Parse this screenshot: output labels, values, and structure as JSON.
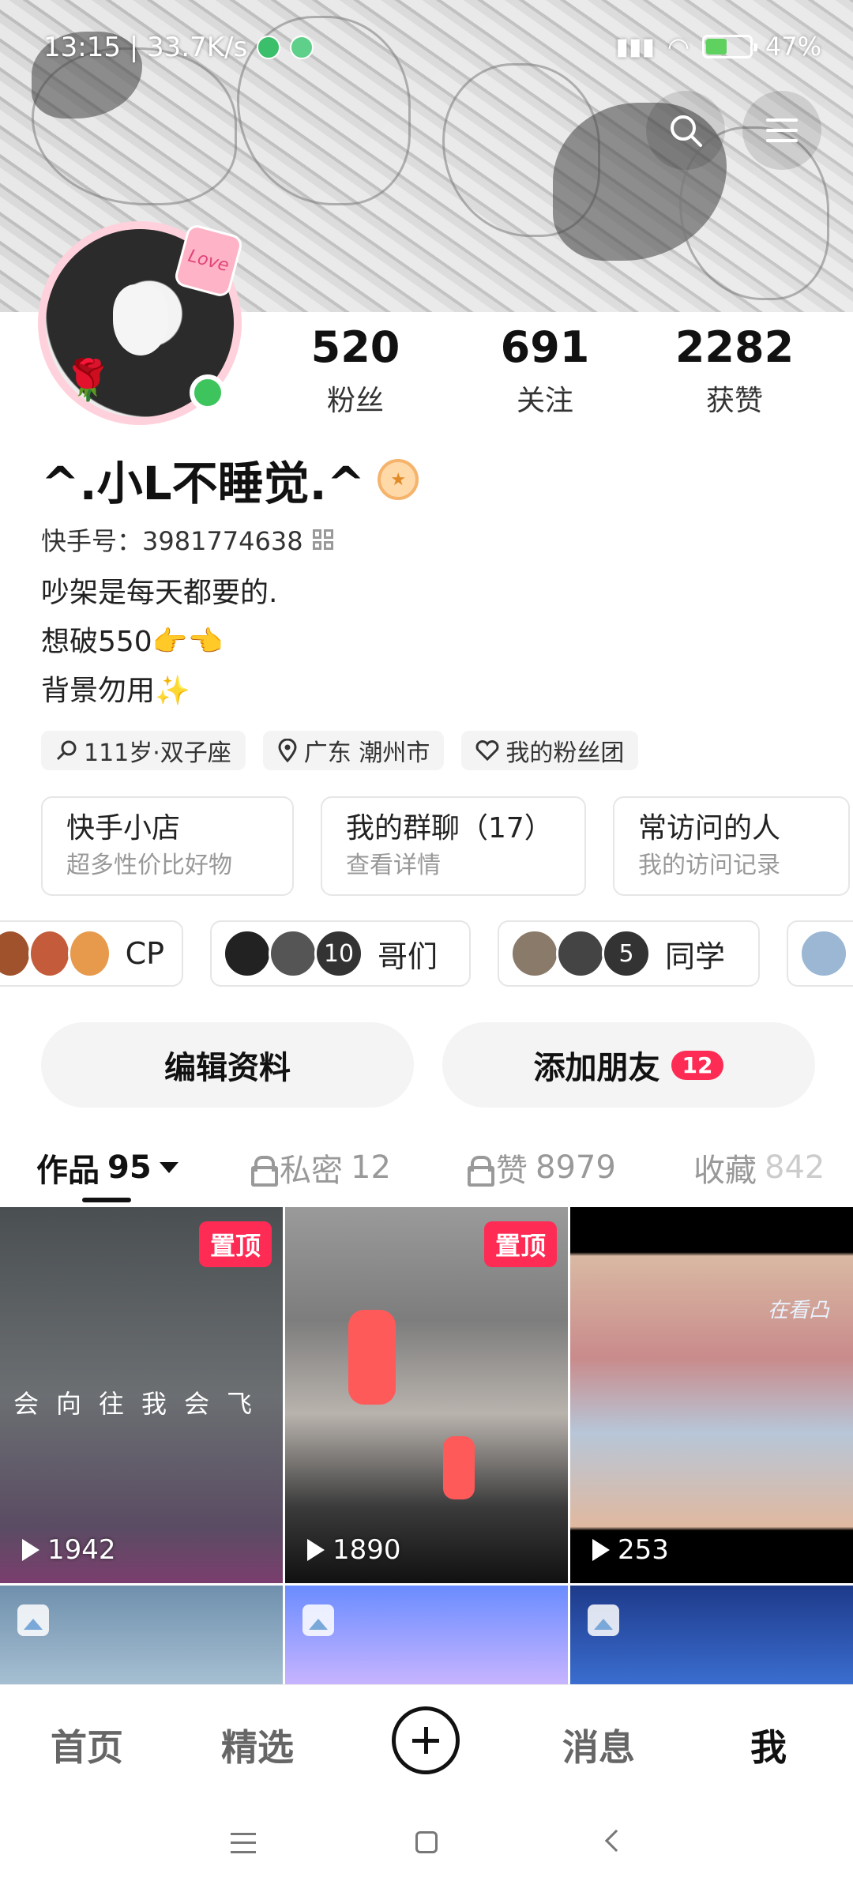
{
  "status_bar": {
    "time_speed": "13:15 | 33.7K/s",
    "battery": "47%"
  },
  "profile": {
    "username": "^.小L不睡觉.^",
    "user_id_label": "快手号：3981774638",
    "bio_lines": [
      "吵架是每天都要的.",
      "想破550👉👈",
      "背景勿用✨"
    ],
    "avatar_tag": "Love",
    "tags": [
      {
        "icon": "gender-icon",
        "label": "111岁·双子座"
      },
      {
        "icon": "location-icon",
        "label": "广东 潮州市"
      },
      {
        "icon": "heart-icon",
        "label": "我的粉丝团"
      }
    ]
  },
  "stats": [
    {
      "value": "520",
      "label": "粉丝"
    },
    {
      "value": "691",
      "label": "关注"
    },
    {
      "value": "2282",
      "label": "获赞"
    }
  ],
  "cards": [
    {
      "title": "快手小店",
      "subtitle": "超多性价比好物"
    },
    {
      "title": "我的群聊（17）",
      "subtitle": "查看详情"
    },
    {
      "title": "常访问的人",
      "subtitle": "我的访问记录"
    }
  ],
  "chips": [
    {
      "label": "CP",
      "count": ""
    },
    {
      "label": "哥们",
      "count": "10"
    },
    {
      "label": "同学",
      "count": "5"
    }
  ],
  "actions": {
    "edit_label": "编辑资料",
    "add_friend_label": "添加朋友",
    "add_friend_badge": "12"
  },
  "tabs": [
    {
      "label": "作品",
      "count": "95"
    },
    {
      "label": "私密",
      "count": "12"
    },
    {
      "label": "赞",
      "count": "8979"
    },
    {
      "label": "收藏",
      "count": "842"
    }
  ],
  "grid": [
    {
      "pinned": "置顶",
      "plays": "1942",
      "caption": "会向往我会飞"
    },
    {
      "pinned": "置顶",
      "plays": "1890",
      "caption": ""
    },
    {
      "pinned": "",
      "plays": "253",
      "caption": "在看凸"
    }
  ],
  "bottom_nav": [
    "首页",
    "精选",
    "消息",
    "我"
  ],
  "colors": {
    "accent": "#fe2c55",
    "online": "#3ec45c"
  }
}
